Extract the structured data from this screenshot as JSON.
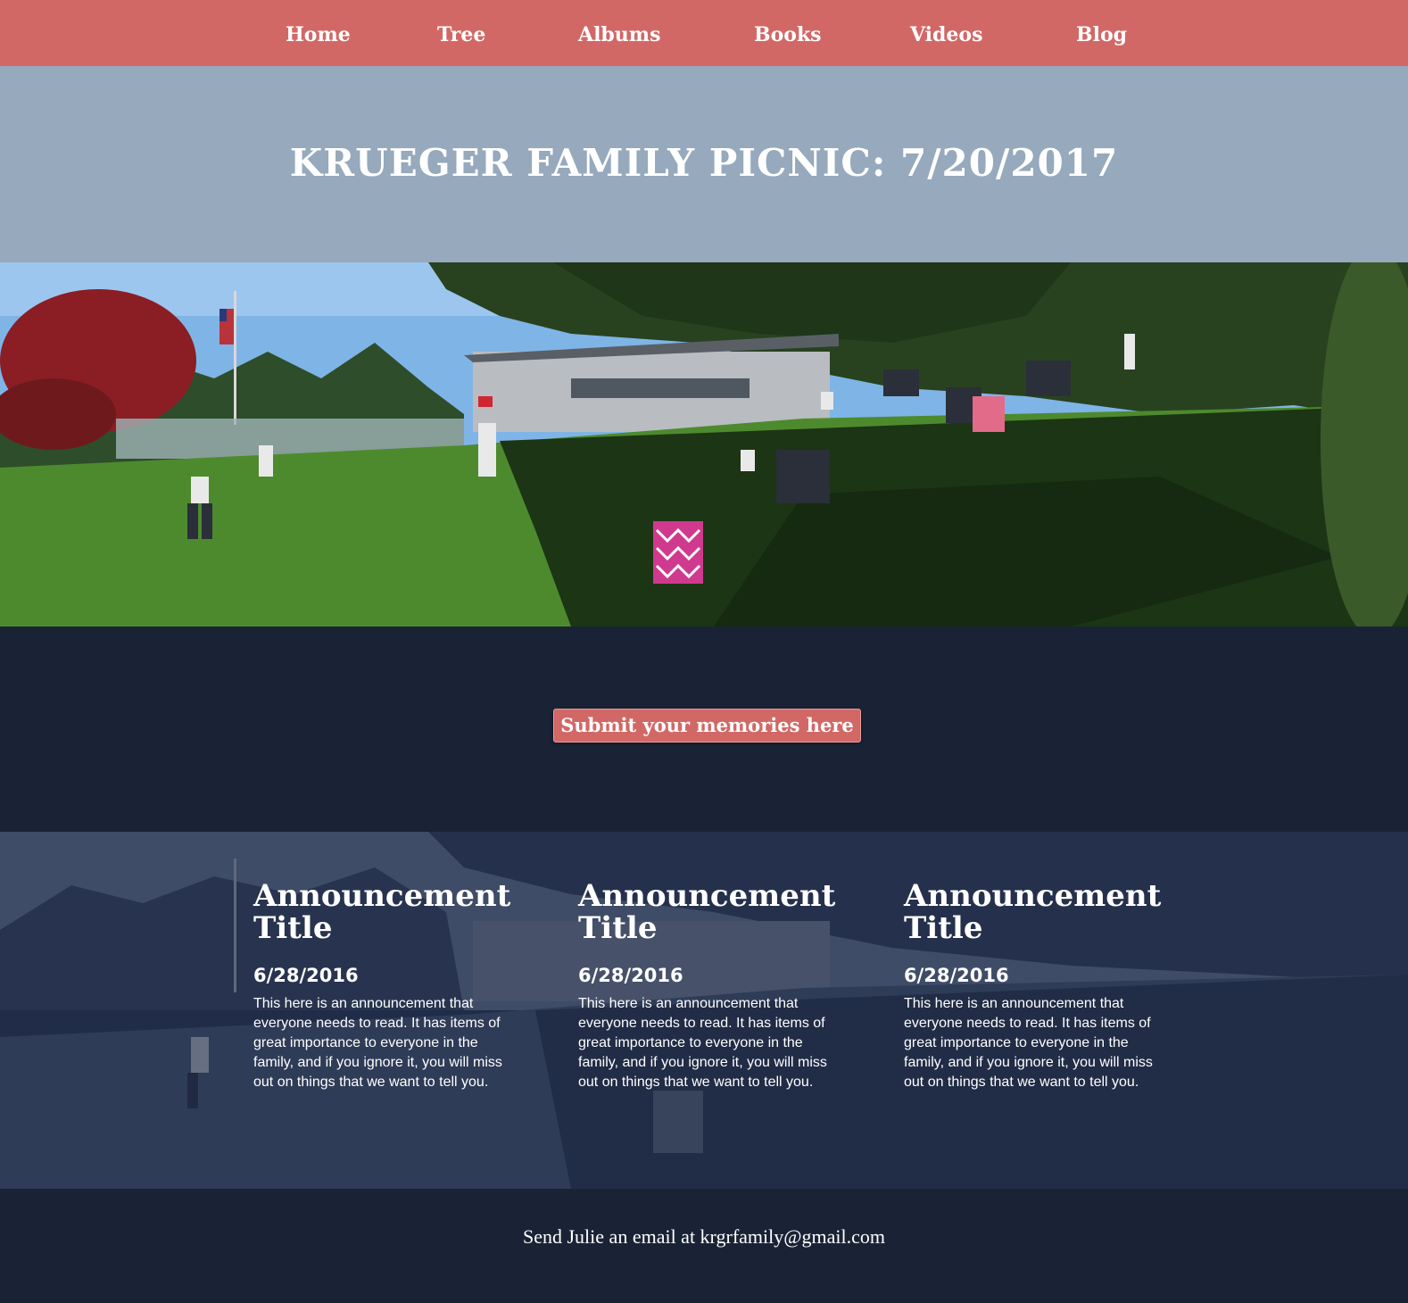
{
  "nav": {
    "items": [
      {
        "label": "Home"
      },
      {
        "label": "Tree"
      },
      {
        "label": "Albums"
      },
      {
        "label": "Books"
      },
      {
        "label": "Videos"
      },
      {
        "label": "Blog"
      }
    ]
  },
  "header": {
    "title": "KRUEGER FAMILY PICNIC: 7/20/2017"
  },
  "submit": {
    "label": "Submit your memories here"
  },
  "announcements": [
    {
      "title": "Announcement Title",
      "date": "6/28/2016",
      "body": "This here is an announcement that everyone needs to read. It has items of great importance to everyone in the family, and if you ignore it, you will miss out on things that we want to tell you."
    },
    {
      "title": "Announcement Title",
      "date": "6/28/2016",
      "body": "This here is an announcement that everyone needs to read. It has items of great importance to everyone in the family, and if you ignore it, you will miss out on things that we want to tell you."
    },
    {
      "title": "Announcement Title",
      "date": "6/28/2016",
      "body": "This here is an announcement that everyone needs to read. It has items of great importance to everyone in the family, and if you ignore it, you will miss out on things that we want to tell you."
    }
  ],
  "footer": {
    "text": "Send Julie an email at krgrfamily@gmail.com"
  },
  "colors": {
    "nav_bg": "#d26866",
    "title_band_bg": "#96a9bd",
    "dark_bg": "#1a2336",
    "button_bg": "#d26866"
  }
}
